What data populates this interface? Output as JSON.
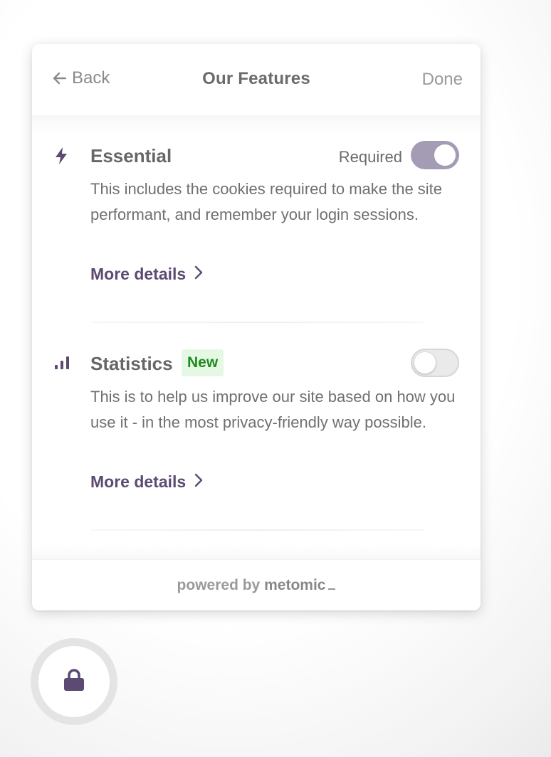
{
  "header": {
    "back_label": "Back",
    "title": "Our Features",
    "done_label": "Done"
  },
  "sections": [
    {
      "icon": "bolt-icon",
      "title": "Essential",
      "status_label": "Required",
      "toggle_on": true,
      "description": "This includes the cookies required to make the site performant, and remember your login sessions.",
      "more_details_label": "More details"
    },
    {
      "icon": "bar-chart-icon",
      "title": "Statistics",
      "badge": "New",
      "toggle_on": false,
      "description": "This is to help us improve our site based on how you use it - in the most privacy-friendly way possible.",
      "more_details_label": "More details"
    }
  ],
  "footer": {
    "powered_by": "powered by",
    "brand": "metomic"
  },
  "lock_button": {
    "icon": "lock-icon"
  },
  "colors": {
    "accent": "#5c4a72",
    "toggle_on": "#a49cb4",
    "badge_bg": "#e4f8e4",
    "badge_text": "#1f8a1f"
  }
}
